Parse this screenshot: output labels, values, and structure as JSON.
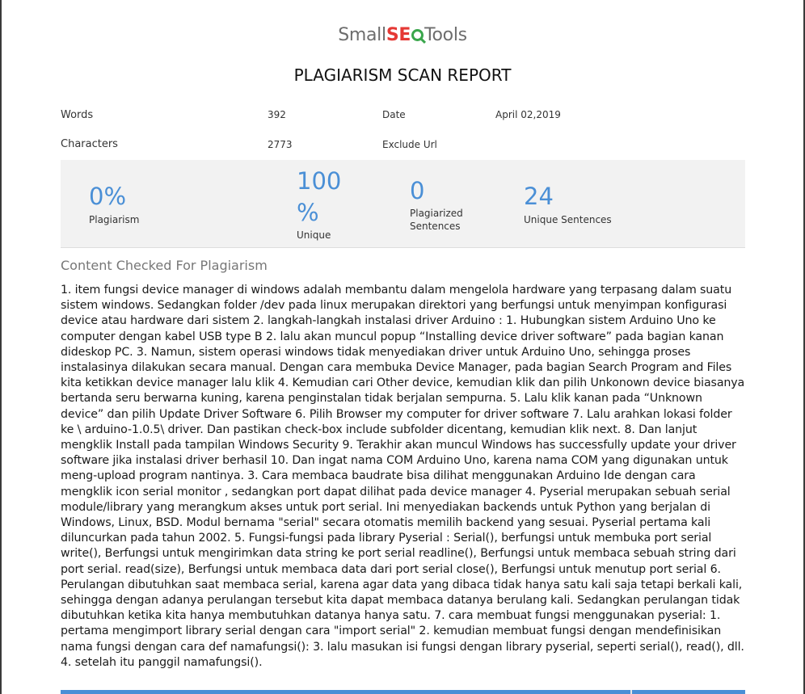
{
  "logo": {
    "part1": "Small",
    "part2": "SE",
    "part3": "Tools"
  },
  "title": "PLAGIARISM SCAN REPORT",
  "meta": {
    "words_label": "Words",
    "words_value": "392",
    "date_label": "Date",
    "date_value": "April 02,2019",
    "characters_label": "Characters",
    "characters_value": "2773",
    "exclude_label": "Exclude Url"
  },
  "stats": {
    "plagiarism_value": "0%",
    "plagiarism_label": "Plagiarism",
    "unique_value_line1": "100",
    "unique_value_line2": "%",
    "unique_label": "Unique",
    "plag_sentences_value": "0",
    "plag_sentences_label_line1": "Plagiarized",
    "plag_sentences_label_line2": "Sentences",
    "unique_sentences_value": "24",
    "unique_sentences_label": "Unique Sentences"
  },
  "section_title": "Content Checked For Plagiarism",
  "content_text": "1. item fungsi device manager di windows adalah membantu dalam mengelola hardware yang terpasang dalam suatu sistem windows. Sedangkan folder /dev pada linux merupakan direktori yang berfungsi untuk menyimpan konfigurasi device atau hardware dari sistem 2. langkah-langkah instalasi driver Arduino : 1. Hubungkan sistem Arduino Uno ke computer dengan kabel USB type B 2. lalu akan muncul popup “Installing device driver software” pada bagian kanan dideskop PC. 3. Namun, sistem operasi windows tidak menyediakan driver untuk Arduino Uno, sehingga proses instalasinya dilakukan secara manual. Dengan cara membuka Device Manager, pada bagian Search Program and Files kita ketikkan device manager lalu klik 4. Kemudian cari Other device, kemudian klik dan pilih Unkonown device biasanya bertanda seru berwarna kuning, karena penginstalan tidak berjalan sempurna. 5. Lalu klik kanan pada “Unknown device” dan pilih Update Driver Software 6. Pilih Browser my computer for driver software 7. Lalu arahkan lokasi folder ke \\ arduino-1.0.5\\ driver. Dan pastikan check-box include subfolder dicentang, kemudian klik next. 8. Dan lanjut mengklik Install pada tampilan Windows Security 9. Terakhir akan muncul Windows has successfully update your driver software jika instalasi driver berhasil 10. Dan ingat nama COM Arduino Uno, karena nama COM yang digunakan untuk meng-upload program nantinya. 3. Cara membaca baudrate bisa dilihat menggunakan Arduino Ide dengan cara mengklik icon serial monitor , sedangkan port dapat dilihat pada device manager 4. Pyserial merupakan sebuah serial module/library yang merangkum akses untuk port serial. Ini menyediakan backends untuk Python yang berjalan di Windows, Linux, BSD. Modul bernama \"serial\" secara otomatis memilih backend yang sesuai. Pyserial pertama kali diluncurkan pada tahun 2002. 5. Fungsi-fungsi pada library Pyserial : Serial(), berfungsi untuk membuka port serial write(), Berfungsi untuk mengirimkan data string ke port serial readline(), Berfungsi untuk membaca sebuah string dari port serial. read(size), Berfungsi untuk membaca data dari port serial close(), Berfungsi untuk menutup port serial 6. Perulangan dibutuhkan saat membaca serial, karena agar data yang dibaca tidak hanya satu kali saja tetapi berkali kali, sehingga dengan adanya perulangan tersebut kita dapat membaca datanya berulang kali. Sedangkan perulangan tidak dibutuhkan ketika kita hanya membutuhkan datanya hanya satu. 7. cara membuat fungsi menggunakan pyserial: 1. pertama mengimport library serial dengan cara \"import serial\" 2. kemudian membuat fungsi dengan mendefinisikan nama fungsi dengan cara def namafungsi(): 3. lalu masukan isi fungsi dengan library pyserial, seperti serial(), read(), dll. 4. setelah itu panggil namafungsi().",
  "colors": {
    "accent": "#4a8fd6",
    "stats_bg": "#f2f2f2",
    "logo_red": "#e53935",
    "logo_green": "#3aa64c"
  }
}
